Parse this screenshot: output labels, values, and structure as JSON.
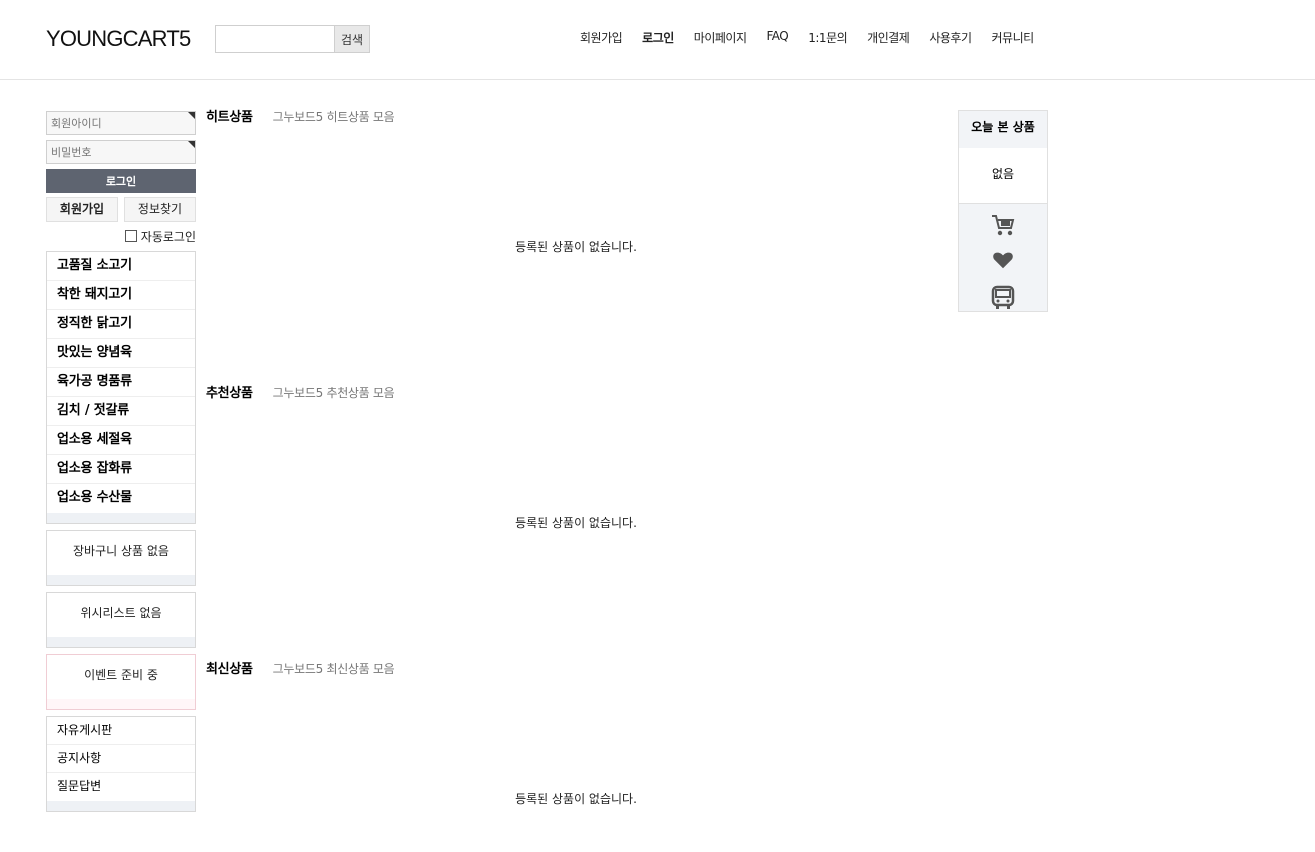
{
  "header": {
    "logo": "YOUNGCART5",
    "search": {
      "value": "",
      "placeholder": "",
      "button_label": "검색"
    },
    "nav": [
      {
        "label": "회원가입",
        "bold": false
      },
      {
        "label": "로그인",
        "bold": true
      },
      {
        "label": "마이페이지",
        "bold": false
      },
      {
        "label": "FAQ",
        "bold": false
      },
      {
        "label": "1:1문의",
        "bold": false
      },
      {
        "label": "개인결제",
        "bold": false
      },
      {
        "label": "사용후기",
        "bold": false
      },
      {
        "label": "커뮤니티",
        "bold": false
      }
    ]
  },
  "login": {
    "id_placeholder": "회원아이디",
    "pw_placeholder": "비밀번호",
    "login_button": "로그인",
    "join_link": "회원가입",
    "find_link": "정보찾기",
    "auto_login_label": "자동로그인"
  },
  "categories": [
    "고품질 소고기",
    "착한 돼지고기",
    "정직한 닭고기",
    "맛있는 양념육",
    "육가공 명품류",
    "김치 / 젓갈류",
    "업소용 세절육",
    "업소용 잡화류",
    "업소용 수산물"
  ],
  "cart": {
    "message": "장바구니 상품 없음"
  },
  "wishlist": {
    "message": "위시리스트 없음"
  },
  "event": {
    "message": "이벤트 준비 중"
  },
  "boards": [
    "자유게시판",
    "공지사항",
    "질문답변"
  ],
  "sections": [
    {
      "title": "히트상품",
      "subtitle": "그누보드5 히트상품 모음",
      "empty": "등록된 상품이 없습니다."
    },
    {
      "title": "추천상품",
      "subtitle": "그누보드5 추천상품 모음",
      "empty": "등록된 상품이 없습니다."
    },
    {
      "title": "최신상품",
      "subtitle": "그누보드5 최신상품 모음",
      "empty": "등록된 상품이 없습니다."
    }
  ],
  "quick": {
    "title": "오늘 본 상품",
    "empty": "없음",
    "icons": [
      "cart-icon",
      "heart-icon",
      "bus-icon"
    ]
  },
  "colors": {
    "login_button_bg": "#5e6470",
    "panel_bg": "#f2f4f7",
    "icon_color": "#555555"
  }
}
